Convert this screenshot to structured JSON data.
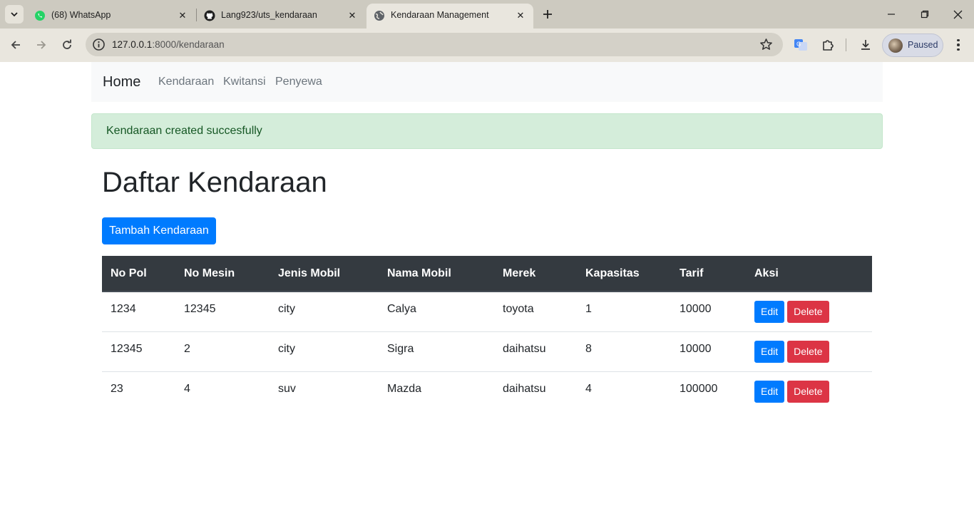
{
  "browser": {
    "tabs": [
      {
        "title": "(68) WhatsApp",
        "icon": "whatsapp-icon",
        "active": false
      },
      {
        "title": "Lang923/uts_kendaraan",
        "icon": "github-icon",
        "active": false
      },
      {
        "title": "Kendaraan Management",
        "icon": "globe-icon",
        "active": true
      }
    ],
    "url_host": "127.0.0.1",
    "url_path": ":8000/kendaraan",
    "profile_label": "Paused"
  },
  "navbar": {
    "brand": "Home",
    "links": [
      "Kendaraan",
      "Kwitansi",
      "Penyewa"
    ]
  },
  "alert": {
    "message": "Kendaraan created succesfully"
  },
  "page": {
    "title": "Daftar Kendaraan",
    "add_button": "Tambah Kendaraan"
  },
  "table": {
    "headers": [
      "No Pol",
      "No Mesin",
      "Jenis Mobil",
      "Nama Mobil",
      "Merek",
      "Kapasitas",
      "Tarif",
      "Aksi"
    ],
    "rows": [
      {
        "no_pol": "1234",
        "no_mesin": "12345",
        "jenis": "city",
        "nama": "Calya",
        "merek": "toyota",
        "kapasitas": "1",
        "tarif": "10000"
      },
      {
        "no_pol": "12345",
        "no_mesin": "2",
        "jenis": "city",
        "nama": "Sigra",
        "merek": "daihatsu",
        "kapasitas": "8",
        "tarif": "10000"
      },
      {
        "no_pol": "23",
        "no_mesin": "4",
        "jenis": "suv",
        "nama": "Mazda",
        "merek": "daihatsu",
        "kapasitas": "4",
        "tarif": "100000"
      }
    ],
    "edit_label": "Edit",
    "delete_label": "Delete"
  },
  "colors": {
    "primary": "#007bff",
    "danger": "#dc3545",
    "table_header": "#343a40",
    "alert_bg": "#d4edda",
    "alert_text": "#155724"
  }
}
